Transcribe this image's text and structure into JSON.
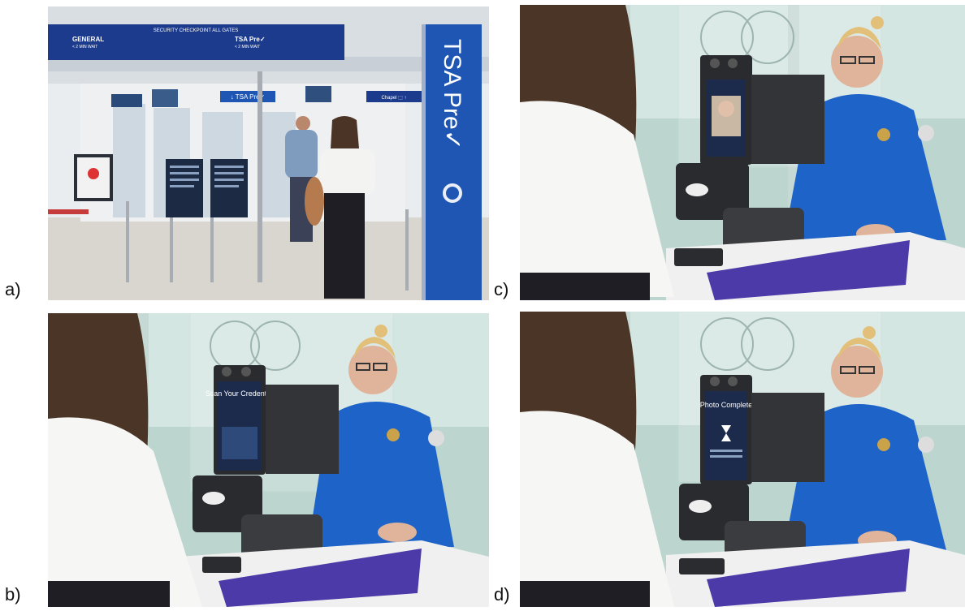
{
  "labels": {
    "a": "a)",
    "b": "b)",
    "c": "c)",
    "d": "d)"
  },
  "panel_a": {
    "banner_title": "SECURITY CHECKPOINT ALL GATES",
    "banner_left": "GENERAL",
    "banner_left_sub": "< 2 MIN WAIT",
    "banner_right": "TSA Pre✓",
    "banner_right_sub": "< 2 MIN WAIT",
    "overhead_sign": "↓ TSA Pre✓",
    "gate_sign": "Chapel ⬚ ↑",
    "column_sign": "TSA Pre✓"
  },
  "panel_b": {
    "screen_text": "Scan Your Credential"
  },
  "panel_d": {
    "screen_text": "Photo Complete"
  },
  "colors": {
    "tsa_blue": "#1f56b3",
    "uniform_blue": "#1e63c8",
    "kiosk_purple": "#4b3aa8",
    "glass_bg": "#bcd6cf"
  }
}
